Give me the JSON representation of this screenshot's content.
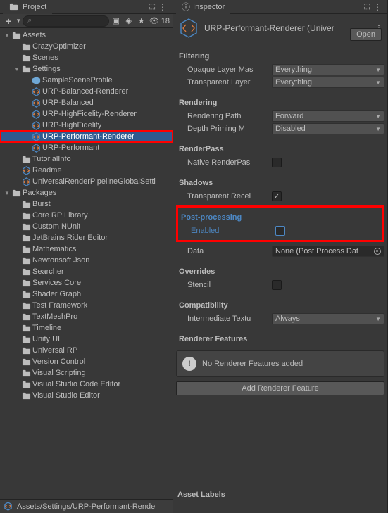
{
  "project": {
    "tab": "Project",
    "search": "",
    "search_placeholder": "",
    "visible_count": "18",
    "footer": "Assets/Settings/URP-Performant-Rende",
    "roots": [
      {
        "kind": "folder",
        "label": "Assets",
        "expanded": true,
        "depth": 0,
        "children": [
          {
            "kind": "folder",
            "label": "CrazyOptimizer",
            "expanded": false,
            "depth": 1
          },
          {
            "kind": "folder",
            "label": "Scenes",
            "expanded": false,
            "depth": 1
          },
          {
            "kind": "folder",
            "label": "Settings",
            "expanded": true,
            "depth": 1,
            "children": [
              {
                "kind": "prefab",
                "label": "SampleSceneProfile",
                "depth": 2
              },
              {
                "kind": "urp",
                "label": "URP-Balanced-Renderer",
                "depth": 2
              },
              {
                "kind": "urp",
                "label": "URP-Balanced",
                "depth": 2
              },
              {
                "kind": "urp",
                "label": "URP-HighFidelity-Renderer",
                "depth": 2
              },
              {
                "kind": "urp",
                "label": "URP-HighFidelity",
                "depth": 2
              },
              {
                "kind": "urp",
                "label": "URP-Performant-Renderer",
                "depth": 2,
                "selected": true,
                "hl": true
              },
              {
                "kind": "urp",
                "label": "URP-Performant",
                "depth": 2
              }
            ]
          },
          {
            "kind": "folder",
            "label": "TutorialInfo",
            "expanded": false,
            "depth": 1
          },
          {
            "kind": "urp",
            "label": "Readme",
            "depth": 1
          },
          {
            "kind": "urp",
            "label": "UniversalRenderPipelineGlobalSetti",
            "depth": 1
          }
        ]
      },
      {
        "kind": "folder",
        "label": "Packages",
        "expanded": true,
        "depth": 0,
        "children": [
          {
            "kind": "folder",
            "label": "Burst",
            "expanded": false,
            "depth": 1
          },
          {
            "kind": "folder",
            "label": "Core RP Library",
            "expanded": false,
            "depth": 1
          },
          {
            "kind": "folder",
            "label": "Custom NUnit",
            "expanded": false,
            "depth": 1
          },
          {
            "kind": "folder",
            "label": "JetBrains Rider Editor",
            "expanded": false,
            "depth": 1
          },
          {
            "kind": "folder",
            "label": "Mathematics",
            "expanded": false,
            "depth": 1
          },
          {
            "kind": "folder",
            "label": "Newtonsoft Json",
            "expanded": false,
            "depth": 1
          },
          {
            "kind": "folder",
            "label": "Searcher",
            "expanded": false,
            "depth": 1
          },
          {
            "kind": "folder",
            "label": "Services Core",
            "expanded": false,
            "depth": 1
          },
          {
            "kind": "folder",
            "label": "Shader Graph",
            "expanded": false,
            "depth": 1
          },
          {
            "kind": "folder",
            "label": "Test Framework",
            "expanded": false,
            "depth": 1
          },
          {
            "kind": "folder",
            "label": "TextMeshPro",
            "expanded": false,
            "depth": 1
          },
          {
            "kind": "folder",
            "label": "Timeline",
            "expanded": false,
            "depth": 1
          },
          {
            "kind": "folder",
            "label": "Unity UI",
            "expanded": false,
            "depth": 1
          },
          {
            "kind": "folder",
            "label": "Universal RP",
            "expanded": false,
            "depth": 1
          },
          {
            "kind": "folder",
            "label": "Version Control",
            "expanded": false,
            "depth": 1
          },
          {
            "kind": "folder",
            "label": "Visual Scripting",
            "expanded": false,
            "depth": 1
          },
          {
            "kind": "folder",
            "label": "Visual Studio Code Editor",
            "expanded": false,
            "depth": 1
          },
          {
            "kind": "folder",
            "label": "Visual Studio Editor",
            "expanded": false,
            "depth": 1
          }
        ]
      }
    ]
  },
  "inspector": {
    "tab": "Inspector",
    "title": "URP-Performant-Renderer (Univer",
    "open": "Open",
    "sections": {
      "filtering": {
        "title": "Filtering",
        "opaque_label": "Opaque Layer Mas",
        "opaque_value": "Everything",
        "transparent_label": "Transparent Layer",
        "transparent_value": "Everything"
      },
      "rendering": {
        "title": "Rendering",
        "path_label": "Rendering Path",
        "path_value": "Forward",
        "depth_label": "Depth Priming M",
        "depth_value": "Disabled"
      },
      "renderpass": {
        "title": "RenderPass",
        "native_label": "Native RenderPas",
        "native_checked": false
      },
      "shadows": {
        "title": "Shadows",
        "transp_label": "Transparent Recei",
        "transp_checked": true
      },
      "post": {
        "title": "Post-processing",
        "enabled_label": "Enabled",
        "enabled_checked": false,
        "data_label": "Data",
        "data_value": "None (Post Process Dat"
      },
      "overrides": {
        "title": "Overrides",
        "stencil_label": "Stencil",
        "stencil_checked": false
      },
      "compat": {
        "title": "Compatibility",
        "inter_label": "Intermediate Textu",
        "inter_value": "Always"
      },
      "features": {
        "title": "Renderer Features",
        "empty": "No Renderer Features added",
        "add": "Add Renderer Feature"
      }
    },
    "asset_labels": "Asset Labels"
  }
}
